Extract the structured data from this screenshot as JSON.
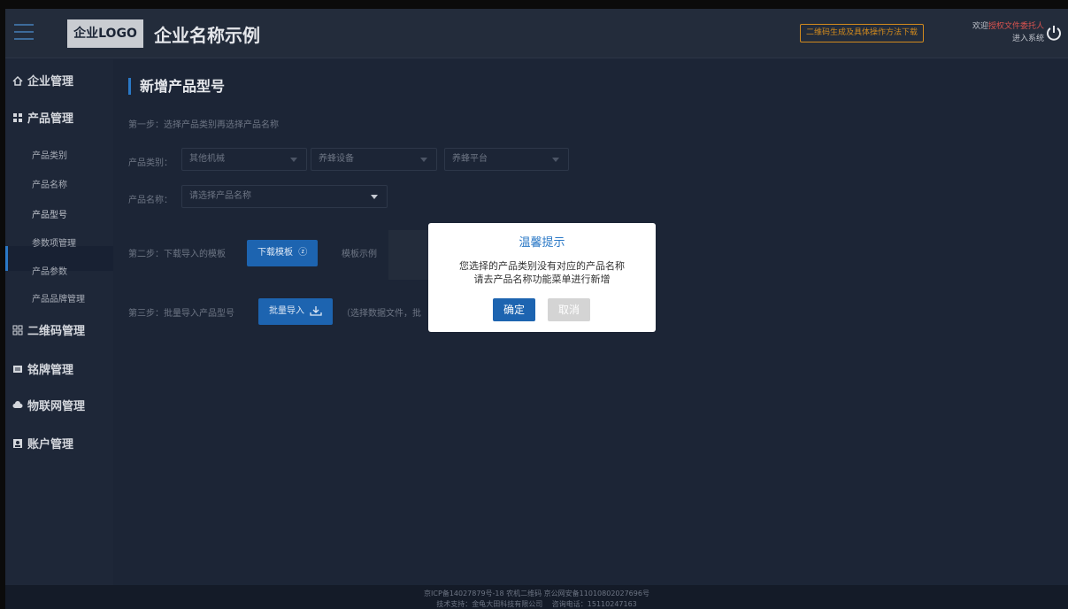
{
  "header": {
    "logo": "企业LOGO",
    "company_name": "企业名称示例",
    "qr_link": "二维码生成及具体操作方法下载",
    "welcome_prefix": "欢迎",
    "user": "授权文件委托人",
    "enter_system": "进入系统"
  },
  "sidebar": {
    "enterprise": "企业管理",
    "product": "产品管理",
    "product_items": [
      "产品类别",
      "产品名称",
      "产品型号",
      "参数项管理",
      "产品参数",
      "产品品牌管理"
    ],
    "qrcode": "二维码管理",
    "nameplate": "铭牌管理",
    "iot": "物联网管理",
    "account": "账户管理"
  },
  "main": {
    "title": "新增产品型号",
    "step1": "第一步：选择产品类别再选择产品名称",
    "category_label": "产品类别：",
    "category_1": "其他机械",
    "category_2": "养蜂设备",
    "category_3": "养蜂平台",
    "name_label": "产品名称：",
    "name_placeholder": "请选择产品名称",
    "step2": "第二步：下载导入的模板",
    "download_btn": "下载模板",
    "sample_label": "模板示例",
    "step3": "第三步：批量导入产品型号",
    "import_btn": "批量导入",
    "import_hint": "（选择数据文件，批"
  },
  "dialog": {
    "title": "温馨提示",
    "line1": "您选择的产品类别没有对应的产品名称",
    "line2": "请去产品名称功能菜单进行新增",
    "ok": "确定",
    "cancel": "取消"
  },
  "footer": {
    "line1": "京ICP备14027879号-18 农机二维码 京公网安备11010802027696号",
    "line2": "技术支持：金龟大田科技有限公司　 咨询电话：15110247163"
  }
}
